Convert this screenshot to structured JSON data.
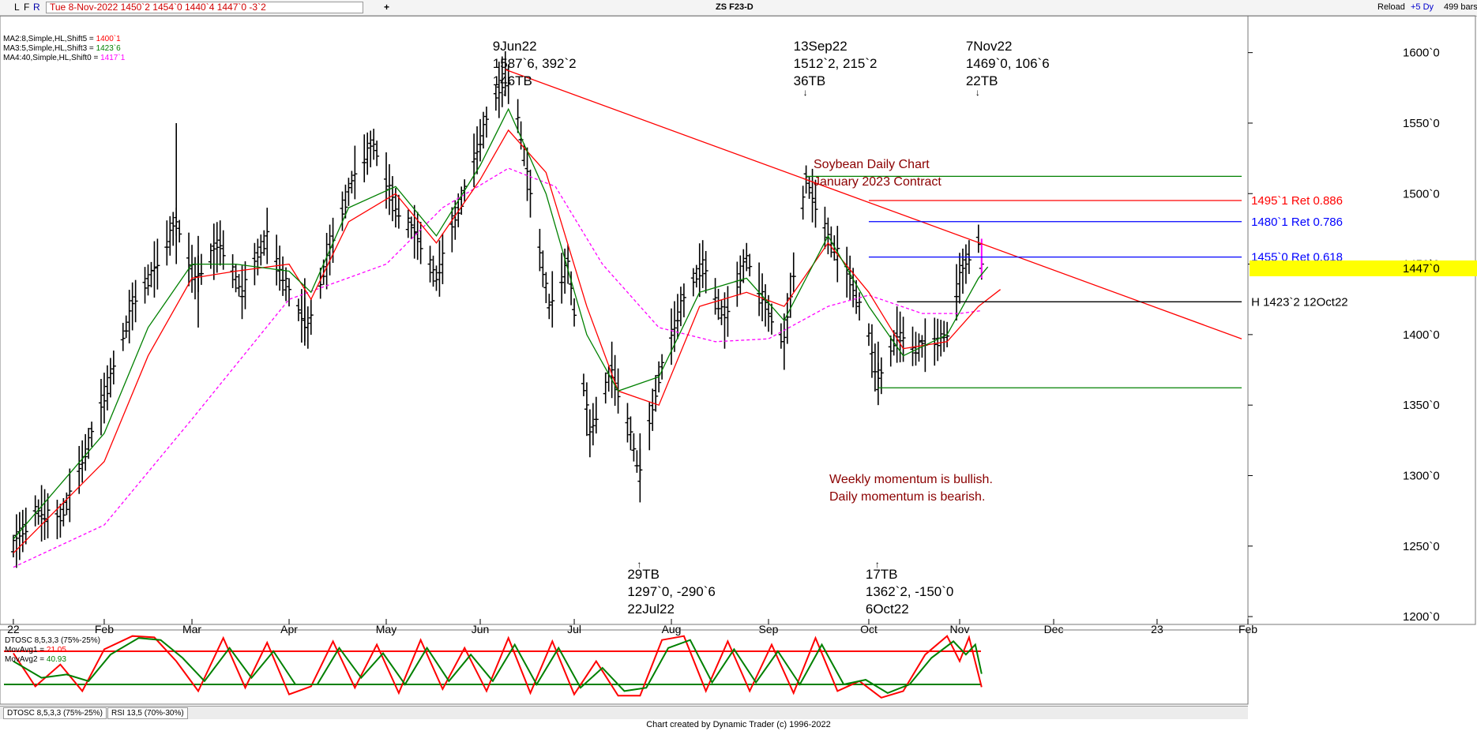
{
  "window": {
    "buttons": [
      "L",
      "F",
      "R"
    ],
    "quote": "Tue 8-Nov-2022   1450`2   1454`0   1440`4   1447`0   -3`2",
    "add_tab": "+",
    "symbol_title": "ZS F23-D",
    "reload_label": "Reload",
    "offset_label": "+5 Dy",
    "bars_label": "499 bars"
  },
  "indicators": {
    "ma1": {
      "label": "MA2:8,Simple,HL,Shift5 = ",
      "value": "1400`1",
      "color": "#ff0000"
    },
    "ma2": {
      "label": "MA3:5,Simple,HL,Shift3 = ",
      "value": "1423`6",
      "color": "#008000"
    },
    "ma3": {
      "label": "MA4:40,Simple,HL,Shift0 = ",
      "value": "1417`1",
      "color": "#ff00ff"
    }
  },
  "oscillator": {
    "title": "DTOSC 8,5,3,3 (75%-25%)",
    "mav1": {
      "label": "MovAvg1 = ",
      "value": "21.05",
      "color": "#ff0000"
    },
    "mav2": {
      "label": "MovAvg2 = ",
      "value": "40.93",
      "color": "#008000"
    },
    "upper": 75,
    "lower": 25
  },
  "tabs": [
    "DTOSC 8,5,3,3 (75%-25%)",
    "RSI 13,5 (70%-30%)"
  ],
  "footer": "Chart created by Dynamic Trader  (c) 1996-2022",
  "chart_data": {
    "type": "bar",
    "title": "Soybean Daily Chart",
    "subtitle": "January 2023 Contract",
    "ylim": [
      1195,
      1625
    ],
    "y_ticks": [
      {
        "v": 1600,
        "label": "1600`0"
      },
      {
        "v": 1550,
        "label": "1550`0"
      },
      {
        "v": 1500,
        "label": "1500`0"
      },
      {
        "v": 1450,
        "label": "1450`0"
      },
      {
        "v": 1400,
        "label": "1400`0"
      },
      {
        "v": 1350,
        "label": "1350`0"
      },
      {
        "v": 1300,
        "label": "1300`0"
      },
      {
        "v": 1250,
        "label": "1250`0"
      },
      {
        "v": 1200,
        "label": "1200`0"
      }
    ],
    "x_ticks": [
      {
        "d": "2022-01-03",
        "label": "22"
      },
      {
        "d": "2022-02-01",
        "label": "Feb"
      },
      {
        "d": "2022-03-01",
        "label": "Mar"
      },
      {
        "d": "2022-04-01",
        "label": "Apr"
      },
      {
        "d": "2022-05-02",
        "label": "May"
      },
      {
        "d": "2022-06-01",
        "label": "Jun"
      },
      {
        "d": "2022-07-01",
        "label": "Jul"
      },
      {
        "d": "2022-08-01",
        "label": "Aug"
      },
      {
        "d": "2022-09-01",
        "label": "Sep"
      },
      {
        "d": "2022-10-03",
        "label": "Oct"
      },
      {
        "d": "2022-11-01",
        "label": "Nov"
      },
      {
        "d": "2022-12-01",
        "label": "Dec"
      },
      {
        "d": "2023-01-03",
        "label": "23"
      },
      {
        "d": "2023-02-01",
        "label": "Feb"
      }
    ],
    "x_range": [
      "2021-12-31",
      "2023-02-01"
    ],
    "last_price": {
      "value": 1447,
      "label": "1447`0"
    },
    "swing_path": [
      [
        "2022-01-03",
        1250
      ],
      [
        "2022-01-10",
        1275
      ],
      [
        "2022-01-18",
        1268
      ],
      [
        "2022-01-25",
        1310
      ],
      [
        "2022-02-01",
        1355
      ],
      [
        "2022-02-10",
        1420
      ],
      [
        "2022-02-18",
        1450
      ],
      [
        "2022-02-24",
        1480
      ],
      [
        "2022-03-02",
        1440
      ],
      [
        "2022-03-10",
        1465
      ],
      [
        "2022-03-17",
        1430
      ],
      [
        "2022-03-25",
        1470
      ],
      [
        "2022-04-01",
        1430
      ],
      [
        "2022-04-07",
        1405
      ],
      [
        "2022-04-14",
        1460
      ],
      [
        "2022-04-22",
        1515
      ],
      [
        "2022-04-28",
        1535
      ],
      [
        "2022-05-05",
        1490
      ],
      [
        "2022-05-12",
        1470
      ],
      [
        "2022-05-18",
        1440
      ],
      [
        "2022-05-26",
        1495
      ],
      [
        "2022-06-02",
        1545
      ],
      [
        "2022-06-09",
        1585
      ],
      [
        "2022-06-13",
        1555
      ],
      [
        "2022-06-17",
        1500
      ],
      [
        "2022-06-23",
        1420
      ],
      [
        "2022-06-29",
        1450
      ],
      [
        "2022-07-06",
        1330
      ],
      [
        "2022-07-13",
        1375
      ],
      [
        "2022-07-19",
        1330
      ],
      [
        "2022-07-22",
        1300
      ],
      [
        "2022-07-28",
        1370
      ],
      [
        "2022-08-04",
        1420
      ],
      [
        "2022-08-11",
        1450
      ],
      [
        "2022-08-18",
        1410
      ],
      [
        "2022-08-25",
        1455
      ],
      [
        "2022-09-01",
        1415
      ],
      [
        "2022-09-06",
        1395
      ],
      [
        "2022-09-13",
        1510
      ],
      [
        "2022-09-20",
        1470
      ],
      [
        "2022-09-27",
        1440
      ],
      [
        "2022-10-03",
        1400
      ],
      [
        "2022-10-06",
        1365
      ],
      [
        "2022-10-12",
        1400
      ],
      [
        "2022-10-18",
        1390
      ],
      [
        "2022-10-24",
        1395
      ],
      [
        "2022-10-28",
        1400
      ],
      [
        "2022-11-01",
        1440
      ],
      [
        "2022-11-04",
        1455
      ],
      [
        "2022-11-07",
        1468
      ],
      [
        "2022-11-08",
        1447
      ]
    ],
    "spikes": [
      {
        "d": "2022-02-24",
        "h": 1550,
        "l": 1450
      },
      {
        "d": "2022-03-03",
        "h": 1470,
        "l": 1405
      },
      {
        "d": "2022-04-06",
        "h": 1440,
        "l": 1395
      },
      {
        "d": "2022-07-22",
        "h": 1330,
        "l": 1297
      },
      {
        "d": "2022-10-06",
        "h": 1395,
        "l": 1362
      }
    ],
    "fast_ma_path": [
      [
        "2022-01-03",
        1245
      ],
      [
        "2022-02-01",
        1310
      ],
      [
        "2022-02-15",
        1385
      ],
      [
        "2022-03-01",
        1440
      ],
      [
        "2022-03-15",
        1445
      ],
      [
        "2022-04-01",
        1450
      ],
      [
        "2022-04-08",
        1425
      ],
      [
        "2022-04-20",
        1480
      ],
      [
        "2022-05-05",
        1500
      ],
      [
        "2022-05-18",
        1465
      ],
      [
        "2022-06-01",
        1510
      ],
      [
        "2022-06-10",
        1545
      ],
      [
        "2022-06-22",
        1515
      ],
      [
        "2022-07-05",
        1420
      ],
      [
        "2022-07-15",
        1360
      ],
      [
        "2022-07-28",
        1350
      ],
      [
        "2022-08-10",
        1420
      ],
      [
        "2022-08-25",
        1430
      ],
      [
        "2022-09-06",
        1420
      ],
      [
        "2022-09-20",
        1465
      ],
      [
        "2022-10-03",
        1430
      ],
      [
        "2022-10-14",
        1390
      ],
      [
        "2022-10-28",
        1395
      ],
      [
        "2022-11-07",
        1420
      ],
      [
        "2022-11-14",
        1432
      ]
    ],
    "med_ma_path": [
      [
        "2022-01-03",
        1255
      ],
      [
        "2022-02-01",
        1330
      ],
      [
        "2022-02-15",
        1405
      ],
      [
        "2022-03-01",
        1450
      ],
      [
        "2022-03-15",
        1450
      ],
      [
        "2022-04-01",
        1445
      ],
      [
        "2022-04-08",
        1430
      ],
      [
        "2022-04-20",
        1490
      ],
      [
        "2022-05-05",
        1505
      ],
      [
        "2022-05-18",
        1470
      ],
      [
        "2022-06-01",
        1520
      ],
      [
        "2022-06-10",
        1560
      ],
      [
        "2022-06-22",
        1500
      ],
      [
        "2022-07-05",
        1400
      ],
      [
        "2022-07-15",
        1360
      ],
      [
        "2022-07-28",
        1370
      ],
      [
        "2022-08-10",
        1430
      ],
      [
        "2022-08-25",
        1440
      ],
      [
        "2022-09-06",
        1410
      ],
      [
        "2022-09-20",
        1470
      ],
      [
        "2022-10-03",
        1420
      ],
      [
        "2022-10-14",
        1385
      ],
      [
        "2022-10-28",
        1400
      ],
      [
        "2022-11-07",
        1440
      ],
      [
        "2022-11-10",
        1448
      ]
    ],
    "slow_ma_path": [
      [
        "2022-01-03",
        1235
      ],
      [
        "2022-02-01",
        1265
      ],
      [
        "2022-03-01",
        1340
      ],
      [
        "2022-04-01",
        1425
      ],
      [
        "2022-05-02",
        1450
      ],
      [
        "2022-05-20",
        1490
      ],
      [
        "2022-06-10",
        1518
      ],
      [
        "2022-06-25",
        1505
      ],
      [
        "2022-07-10",
        1450
      ],
      [
        "2022-07-28",
        1405
      ],
      [
        "2022-08-15",
        1395
      ],
      [
        "2022-09-01",
        1397
      ],
      [
        "2022-09-20",
        1420
      ],
      [
        "2022-10-03",
        1428
      ],
      [
        "2022-10-20",
        1415
      ],
      [
        "2022-11-01",
        1415
      ],
      [
        "2022-11-08",
        1417
      ]
    ],
    "trendline": {
      "from": [
        "2022-06-09",
        1588
      ],
      "to": [
        "2023-01-30",
        1397
      ]
    },
    "hlines": [
      {
        "y": 1512.25,
        "from": "2022-09-13",
        "to": "2023-01-30",
        "color": "#008000",
        "label": ""
      },
      {
        "y": 1495.125,
        "from": "2022-10-03",
        "to": "2023-01-30",
        "color": "#ff0000",
        "label": "1495`1 Ret 0.886"
      },
      {
        "y": 1480.125,
        "from": "2022-10-03",
        "to": "2023-01-30",
        "color": "#0000ff",
        "label": "1480`1 Ret 0.786"
      },
      {
        "y": 1455,
        "from": "2022-10-03",
        "to": "2023-01-30",
        "color": "#0000ff",
        "label": "1455`0 Ret 0.618"
      },
      {
        "y": 1423.25,
        "from": "2022-10-12",
        "to": "2023-01-30",
        "color": "#000000",
        "label": "H 1423`2 12Oct22"
      },
      {
        "y": 1362.25,
        "from": "2022-10-06",
        "to": "2023-01-30",
        "color": "#008000",
        "label": ""
      }
    ],
    "pivots": [
      {
        "pos": "top",
        "d": "2022-06-09",
        "lines": [
          "9Jun22",
          "1587`6, 392`2",
          "146TB"
        ]
      },
      {
        "pos": "top",
        "d": "2022-09-13",
        "lines": [
          "13Sep22",
          "1512`2, 215`2",
          "36TB"
        ]
      },
      {
        "pos": "top",
        "d": "2022-11-07",
        "lines": [
          "7Nov22",
          "1469`0, 106`6",
          "22TB"
        ]
      },
      {
        "pos": "bottom",
        "d": "2022-07-22",
        "lines": [
          "29TB",
          "1297`0, -290`6",
          "22Jul22"
        ]
      },
      {
        "pos": "bottom",
        "d": "2022-10-06",
        "lines": [
          "17TB",
          "1362`2, -150`0",
          "6Oct22"
        ]
      }
    ],
    "notes": [
      "Weekly momentum is bullish.",
      "Daily momentum is bearish."
    ],
    "osc_fast_path": [
      [
        "2022-01-03",
        72
      ],
      [
        "2022-01-10",
        22
      ],
      [
        "2022-01-18",
        55
      ],
      [
        "2022-01-25",
        15
      ],
      [
        "2022-02-01",
        78
      ],
      [
        "2022-02-10",
        98
      ],
      [
        "2022-02-17",
        96
      ],
      [
        "2022-02-24",
        60
      ],
      [
        "2022-03-03",
        15
      ],
      [
        "2022-03-11",
        95
      ],
      [
        "2022-03-18",
        20
      ],
      [
        "2022-03-25",
        88
      ],
      [
        "2022-04-01",
        10
      ],
      [
        "2022-04-08",
        22
      ],
      [
        "2022-04-15",
        90
      ],
      [
        "2022-04-22",
        20
      ],
      [
        "2022-04-29",
        85
      ],
      [
        "2022-05-06",
        12
      ],
      [
        "2022-05-13",
        92
      ],
      [
        "2022-05-20",
        18
      ],
      [
        "2022-05-27",
        80
      ],
      [
        "2022-06-03",
        15
      ],
      [
        "2022-06-10",
        95
      ],
      [
        "2022-06-17",
        12
      ],
      [
        "2022-06-24",
        90
      ],
      [
        "2022-07-01",
        10
      ],
      [
        "2022-07-08",
        60
      ],
      [
        "2022-07-15",
        8
      ],
      [
        "2022-07-22",
        8
      ],
      [
        "2022-07-29",
        92
      ],
      [
        "2022-08-05",
        98
      ],
      [
        "2022-08-12",
        15
      ],
      [
        "2022-08-19",
        90
      ],
      [
        "2022-08-26",
        15
      ],
      [
        "2022-09-02",
        85
      ],
      [
        "2022-09-09",
        12
      ],
      [
        "2022-09-16",
        95
      ],
      [
        "2022-09-23",
        15
      ],
      [
        "2022-09-30",
        30
      ],
      [
        "2022-10-07",
        5
      ],
      [
        "2022-10-14",
        15
      ],
      [
        "2022-10-21",
        70
      ],
      [
        "2022-10-28",
        98
      ],
      [
        "2022-11-01",
        60
      ],
      [
        "2022-11-04",
        96
      ],
      [
        "2022-11-08",
        21
      ]
    ],
    "osc_slow_path": [
      [
        "2022-01-03",
        60
      ],
      [
        "2022-01-12",
        35
      ],
      [
        "2022-01-20",
        40
      ],
      [
        "2022-01-27",
        30
      ],
      [
        "2022-02-03",
        70
      ],
      [
        "2022-02-12",
        95
      ],
      [
        "2022-02-19",
        92
      ],
      [
        "2022-02-26",
        65
      ],
      [
        "2022-03-05",
        30
      ],
      [
        "2022-03-13",
        80
      ],
      [
        "2022-03-20",
        35
      ],
      [
        "2022-03-27",
        75
      ],
      [
        "2022-04-03",
        25
      ],
      [
        "2022-04-10",
        25
      ],
      [
        "2022-04-17",
        80
      ],
      [
        "2022-04-24",
        35
      ],
      [
        "2022-05-01",
        72
      ],
      [
        "2022-05-08",
        25
      ],
      [
        "2022-05-15",
        80
      ],
      [
        "2022-05-22",
        30
      ],
      [
        "2022-05-29",
        70
      ],
      [
        "2022-06-05",
        30
      ],
      [
        "2022-06-12",
        85
      ],
      [
        "2022-06-19",
        25
      ],
      [
        "2022-06-26",
        80
      ],
      [
        "2022-07-03",
        20
      ],
      [
        "2022-07-10",
        50
      ],
      [
        "2022-07-17",
        15
      ],
      [
        "2022-07-24",
        20
      ],
      [
        "2022-07-31",
        80
      ],
      [
        "2022-08-07",
        92
      ],
      [
        "2022-08-14",
        28
      ],
      [
        "2022-08-21",
        78
      ],
      [
        "2022-08-28",
        28
      ],
      [
        "2022-09-04",
        75
      ],
      [
        "2022-09-11",
        25
      ],
      [
        "2022-09-18",
        85
      ],
      [
        "2022-09-25",
        25
      ],
      [
        "2022-10-02",
        32
      ],
      [
        "2022-10-09",
        12
      ],
      [
        "2022-10-16",
        25
      ],
      [
        "2022-10-23",
        65
      ],
      [
        "2022-10-30",
        90
      ],
      [
        "2022-11-03",
        70
      ],
      [
        "2022-11-06",
        85
      ],
      [
        "2022-11-08",
        41
      ]
    ]
  }
}
